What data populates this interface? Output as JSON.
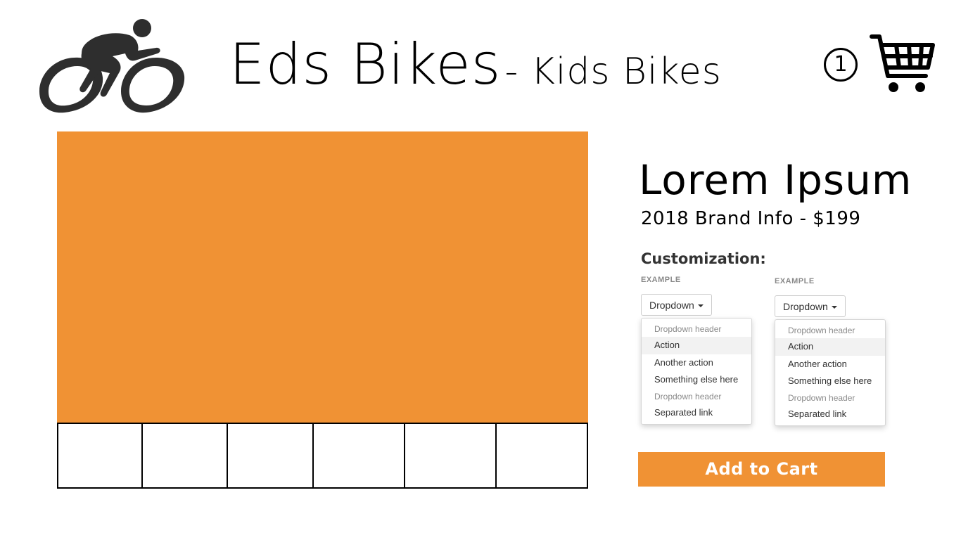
{
  "header": {
    "logo_icon": "cyclist-icon",
    "brand": "Eds Bikes",
    "section": "- Kids Bikes",
    "cart_count": "1",
    "cart_icon": "shopping-cart-icon"
  },
  "gallery": {
    "hero_color": "#f09234",
    "thumbnail_count": 6
  },
  "product": {
    "name": "Lorem Ipsum",
    "info": "2018 Brand Info - $199"
  },
  "customization": {
    "label": "Customization:",
    "dropdowns": [
      {
        "example_label": "EXAMPLE",
        "button_label": "Dropdown",
        "menu": {
          "header1": "Dropdown header",
          "items": [
            "Action",
            "Another action",
            "Something else here"
          ],
          "header2": "Dropdown header",
          "separated": "Separated link"
        }
      },
      {
        "example_label": "EXAMPLE",
        "button_label": "Dropdown",
        "menu": {
          "header1": "Dropdown header",
          "items": [
            "Action",
            "Another action",
            "Something else here"
          ],
          "header2": "Dropdown header",
          "separated": "Separated link"
        }
      }
    ]
  },
  "cta": {
    "add_to_cart": "Add to Cart",
    "color": "#f09234"
  }
}
